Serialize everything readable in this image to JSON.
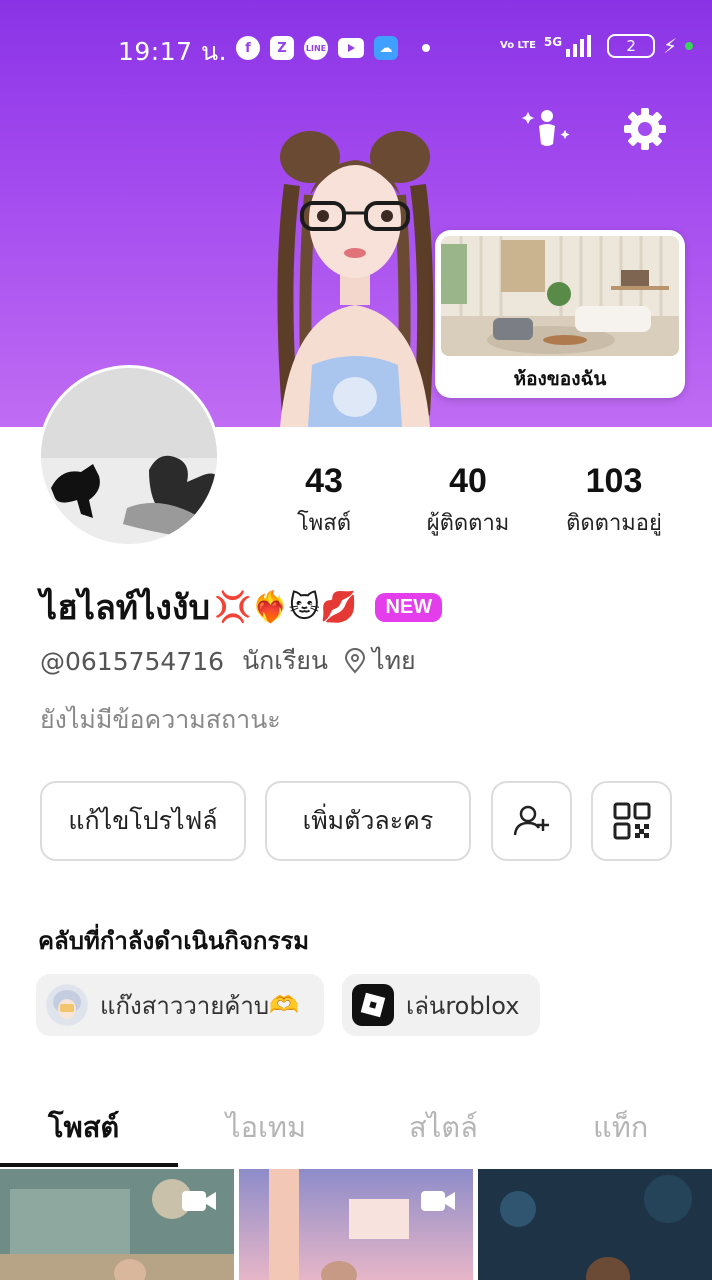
{
  "status_bar": {
    "time": "19:17 น.",
    "notification_icons": [
      "facebook-icon",
      "zalo-icon",
      "line-icon",
      "youtube-icon",
      "weather-icon"
    ],
    "network": "5G",
    "volte": "Vo LTE",
    "battery": "2"
  },
  "header": {
    "room_card_label": "ห้องของฉัน"
  },
  "stats": [
    {
      "count": "43",
      "label": "โพสต์"
    },
    {
      "count": "40",
      "label": "ผู้ติดตาม"
    },
    {
      "count": "103",
      "label": "ติดตามอยู่"
    }
  ],
  "profile": {
    "name": "ไฮไลท์ไงงับ",
    "name_emojis": "💢❤️‍🔥🐱💋",
    "badge": "NEW",
    "handle": "@0615754716",
    "occupation": "นักเรียน",
    "location": "ไทย",
    "status_message": "ยังไม่มีข้อความสถานะ"
  },
  "actions": {
    "edit_profile": "แก้ไขโปรไฟล์",
    "add_character": "เพิ่มตัวละคร"
  },
  "clubs": {
    "title": "คลับที่กำลังดำเนินกิจกรรม",
    "items": [
      {
        "name": "แก๊งสาววายค้าบ",
        "emoji": "🫶"
      },
      {
        "name": "เล่นroblox",
        "emoji": ""
      }
    ]
  },
  "tabs": [
    {
      "label": "โพสต์",
      "active": true
    },
    {
      "label": "ไอเทม",
      "active": false
    },
    {
      "label": "สไตล์",
      "active": false
    },
    {
      "label": "แท็ก",
      "active": false
    }
  ],
  "colors": {
    "hero_top": "#8a33e6",
    "hero_bottom": "#c06cf3",
    "new_badge": "#e33dec"
  }
}
